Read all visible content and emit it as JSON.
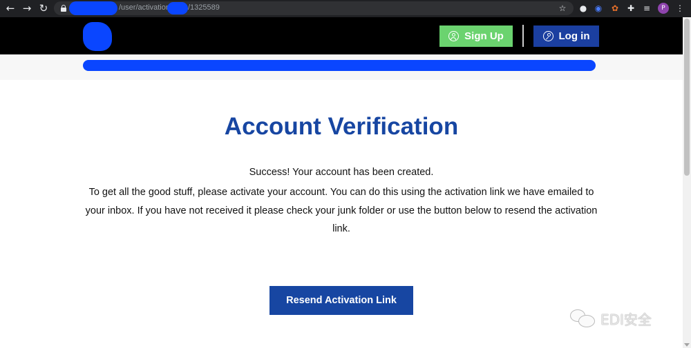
{
  "browser": {
    "url_path": "/user/activation/",
    "url_suffix": "/1325589",
    "profile_initial": "P",
    "icons": [
      "back-arrow-icon",
      "forward-arrow-icon",
      "reload-icon",
      "lock-icon",
      "star-icon",
      "extensions-icon",
      "menu-dots-icon"
    ]
  },
  "header": {
    "signup_label": "Sign Up",
    "login_label": "Log in",
    "colors": {
      "signup": "#6bd36f",
      "login": "#1b3fa0",
      "background": "#000000"
    }
  },
  "main": {
    "title": "Account Verification",
    "success_message": "Success! Your account has been created.",
    "body_message": "To get all the good stuff, please activate your account. You can do this using the activation link we have emailed to your inbox. If you have not received it please check your junk folder or use the button below to resend the activation link.",
    "resend_label": "Resend Activation Link",
    "accent_color": "#1746a2"
  },
  "watermark": {
    "text": "EDI安全"
  }
}
